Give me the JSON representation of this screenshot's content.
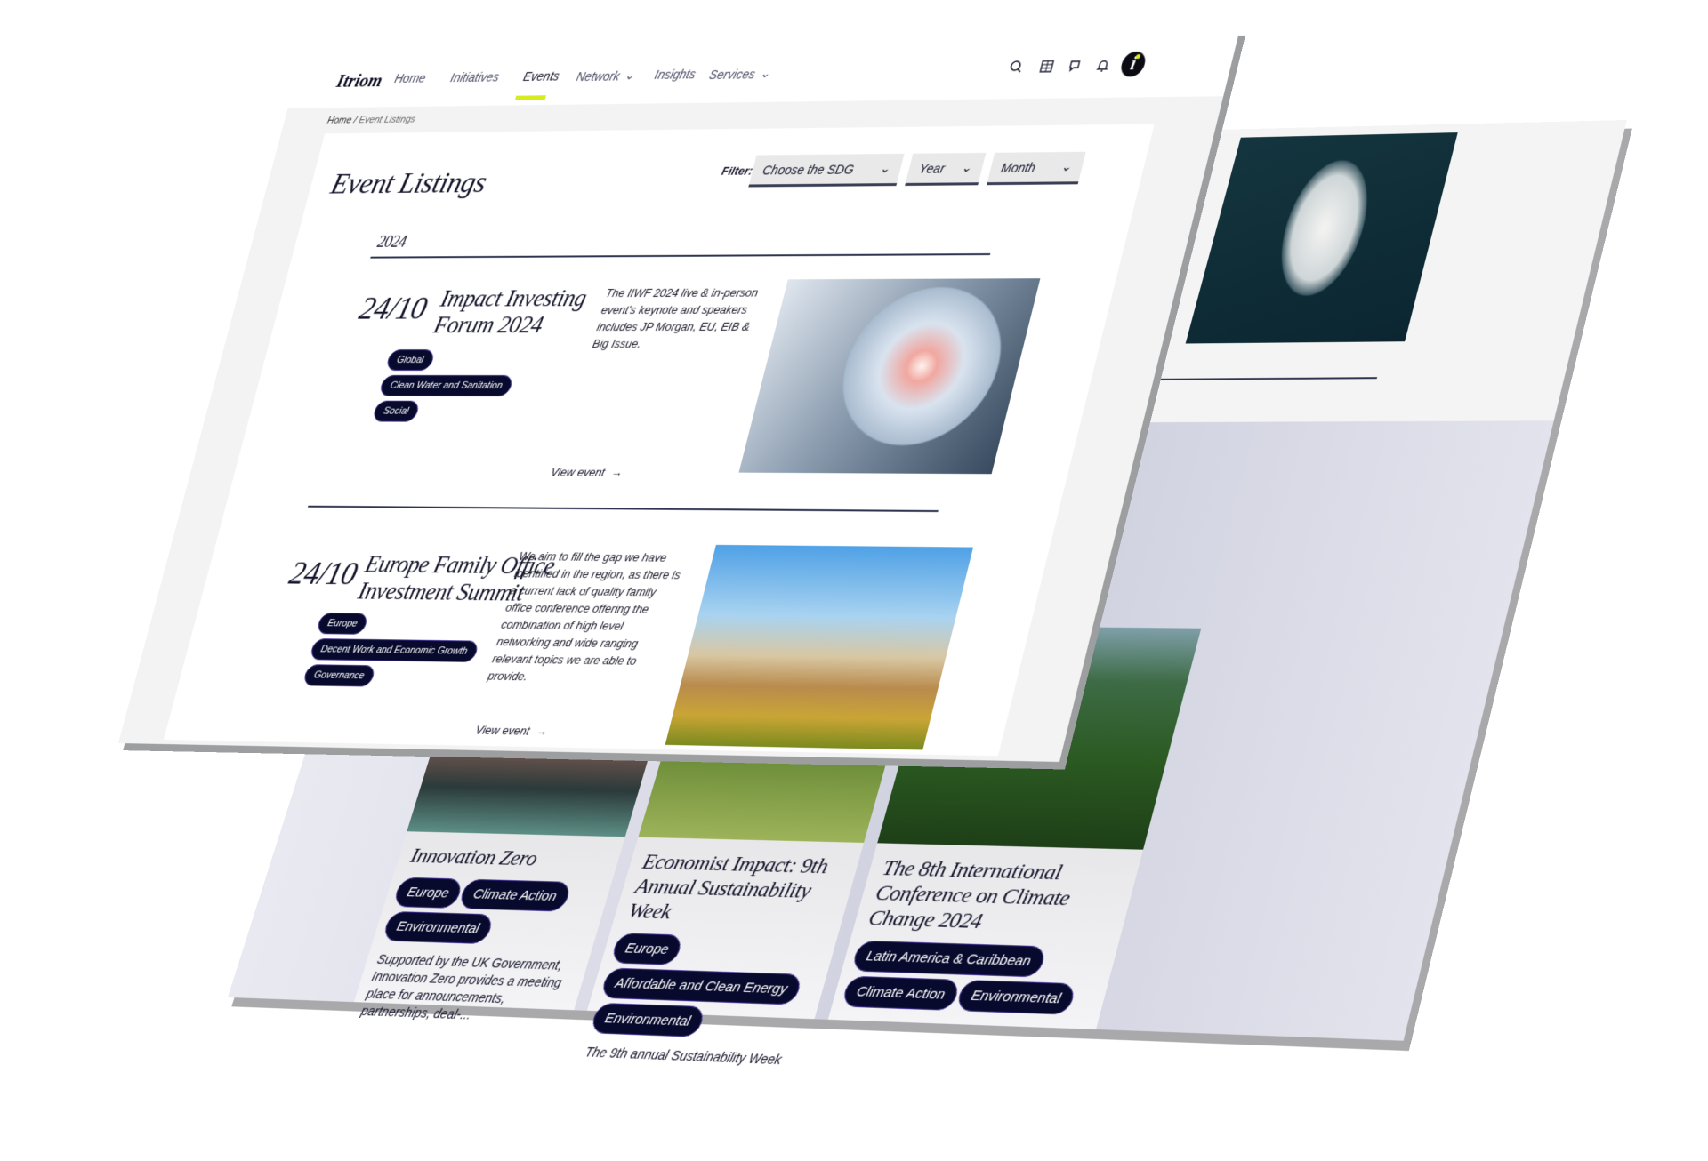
{
  "nav": {
    "logo": "Itriom",
    "items": [
      {
        "label": "Home",
        "dropdown": false
      },
      {
        "label": "Initiatives",
        "dropdown": false
      },
      {
        "label": "Events",
        "dropdown": false,
        "active": true
      },
      {
        "label": "Network",
        "dropdown": true
      },
      {
        "label": "Insights",
        "dropdown": false
      },
      {
        "label": "Services",
        "dropdown": true
      }
    ],
    "icons": [
      "search-icon",
      "calendar-grid-icon",
      "chat-icon",
      "bell-icon",
      "info-avatar-icon"
    ],
    "accent": "#d7ec1f"
  },
  "breadcrumb": {
    "home": "Home",
    "separator": "/",
    "current": "Event Listings"
  },
  "page_title": "Event Listings",
  "filter": {
    "label": "Filter:",
    "sdg": "Choose the SDG",
    "year": "Year",
    "month": "Month"
  },
  "year_heading": "2024",
  "events": [
    {
      "date": "24/10",
      "title_line1": "Impact Investing",
      "title_line2": "Forum 2024",
      "tags": [
        "Global",
        "Clean Water and Sanitation",
        "Social"
      ],
      "description": "The IIWF 2024 live & in-person event's keynote and speakers includes JP Morgan, EU, EIB & Big Issue.",
      "link": "View event"
    },
    {
      "date": "24/10",
      "title_line1": "Europe Family Office",
      "title_line2": "Investment Summit",
      "tags": [
        "Europe",
        "Decent Work and Economic Growth",
        "Governance"
      ],
      "description": "We aim to fill the gap we have identified in the region, as there is a current lack of quality family office conference offering the combination of high level networking and wide ranging relevant topics we are able to provide.",
      "link": "View event"
    }
  ],
  "cards": [
    {
      "title": "Innovation Zero",
      "tags": [
        "Europe",
        "Climate Action",
        "Environmental"
      ],
      "description": "Supported by the UK Government, Innovation Zero provides a meeting place for announcements, partnerships, deal-..."
    },
    {
      "title": "Economist Impact: 9th Annual Sustainability Week",
      "tags": [
        "Europe",
        "Affordable and Clean Energy",
        "Environmental"
      ],
      "description": "The 9th annual Sustainability Week"
    },
    {
      "title": "The 8th International Conference on Climate Change 2024",
      "tags": [
        "Latin America & Caribbean",
        "Climate Action",
        "Environmental"
      ],
      "description": ""
    }
  ],
  "colors": {
    "tag_bg": "#070a2c",
    "text": "#14142b",
    "panel": "#f2f3f2"
  }
}
